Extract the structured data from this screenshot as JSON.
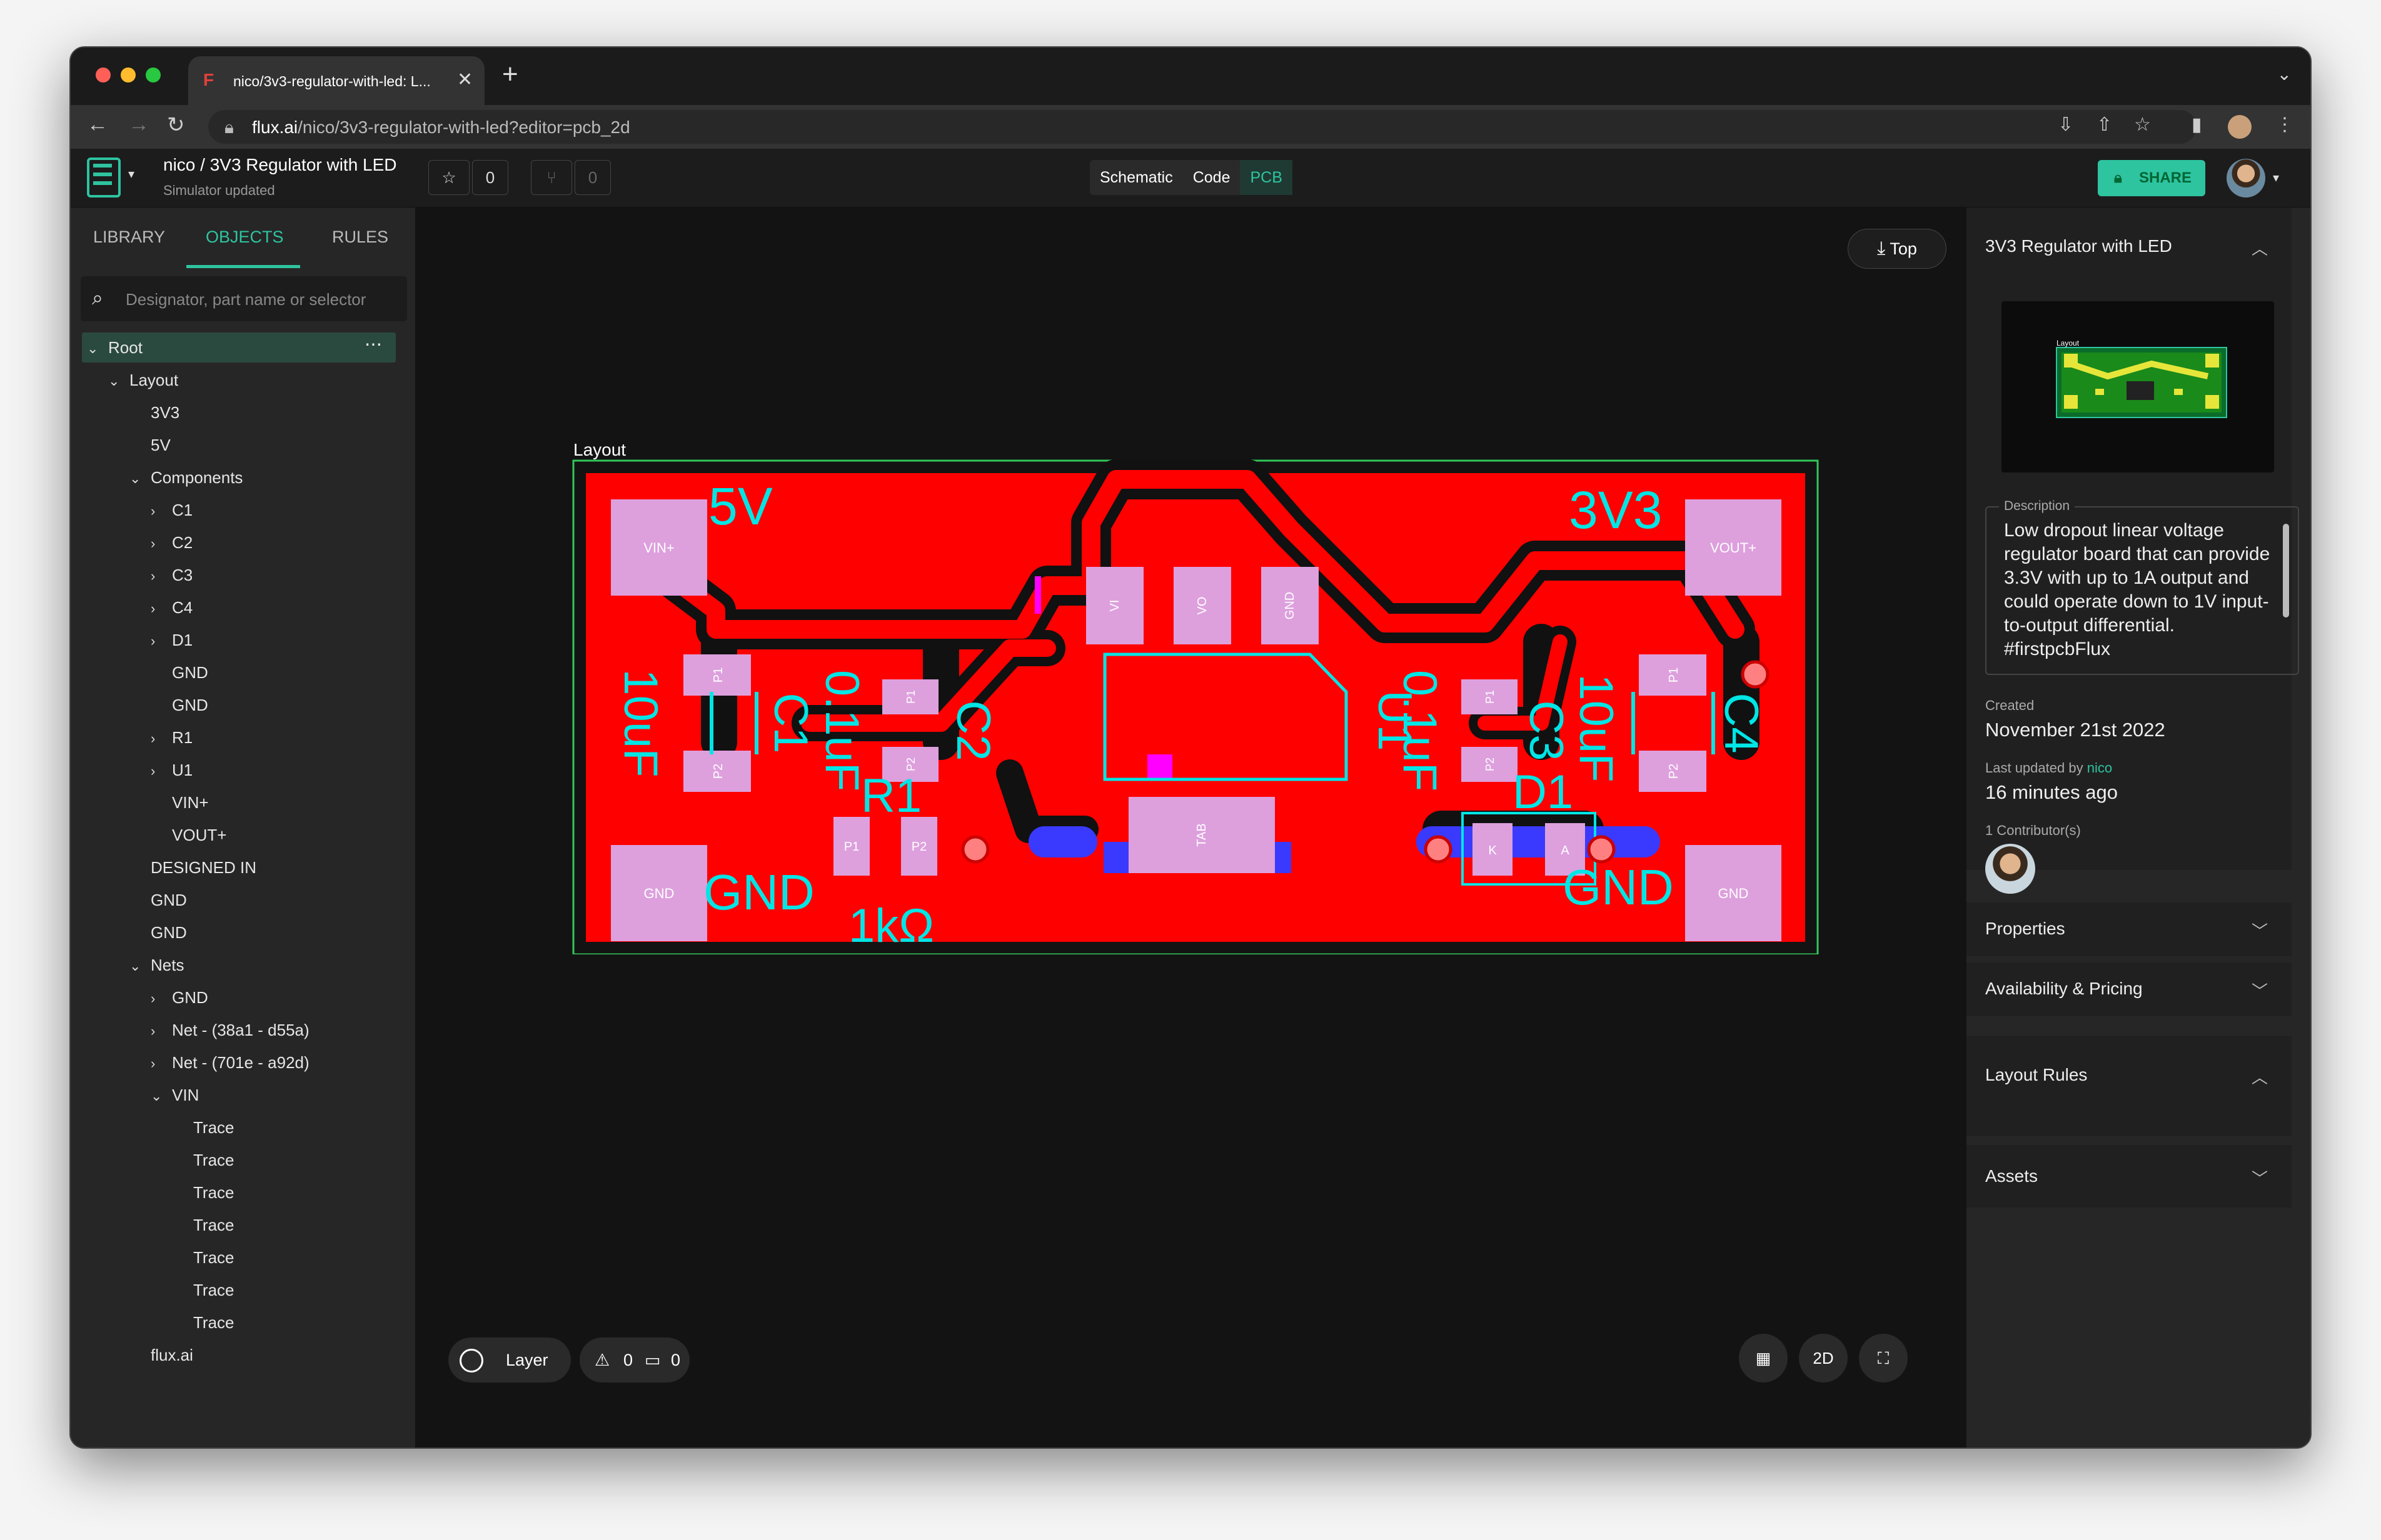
{
  "browser": {
    "tab_title": "nico/3v3-regulator-with-led: L...",
    "url_host": "flux.ai",
    "url_path": "/nico/3v3-regulator-with-led?editor=pcb_2d"
  },
  "header": {
    "project_title": "nico / 3V3 Regulator with LED",
    "status": "Simulator updated",
    "star_count": "0",
    "fork_count": "0",
    "views": [
      "Schematic",
      "Code",
      "PCB"
    ],
    "share_label": "SHARE"
  },
  "left_panel": {
    "tabs": [
      "LIBRARY",
      "OBJECTS",
      "RULES"
    ],
    "search_placeholder": "Designator, part name or selector",
    "tree": [
      {
        "label": "Root",
        "level": 0,
        "caret": "down"
      },
      {
        "label": "Layout",
        "level": 1,
        "caret": "down"
      },
      {
        "label": "3V3",
        "level": 2,
        "caret": ""
      },
      {
        "label": "5V",
        "level": 2,
        "caret": ""
      },
      {
        "label": "Components",
        "level": 2,
        "caret": "down"
      },
      {
        "label": "C1",
        "level": 3,
        "caret": "right"
      },
      {
        "label": "C2",
        "level": 3,
        "caret": "right"
      },
      {
        "label": "C3",
        "level": 3,
        "caret": "right"
      },
      {
        "label": "C4",
        "level": 3,
        "caret": "right"
      },
      {
        "label": "D1",
        "level": 3,
        "caret": "right"
      },
      {
        "label": "GND",
        "level": 3,
        "caret": ""
      },
      {
        "label": "GND",
        "level": 3,
        "caret": ""
      },
      {
        "label": "R1",
        "level": 3,
        "caret": "right"
      },
      {
        "label": "U1",
        "level": 3,
        "caret": "right"
      },
      {
        "label": "VIN+",
        "level": 3,
        "caret": ""
      },
      {
        "label": "VOUT+",
        "level": 3,
        "caret": ""
      },
      {
        "label": "DESIGNED IN",
        "level": 2,
        "caret": ""
      },
      {
        "label": "GND",
        "level": 2,
        "caret": ""
      },
      {
        "label": "GND",
        "level": 2,
        "caret": ""
      },
      {
        "label": "Nets",
        "level": 2,
        "caret": "down"
      },
      {
        "label": "GND",
        "level": 3,
        "caret": "right"
      },
      {
        "label": "Net - (38a1 - d55a)",
        "level": 3,
        "caret": "right"
      },
      {
        "label": "Net - (701e - a92d)",
        "level": 3,
        "caret": "right"
      },
      {
        "label": "VIN",
        "level": 3,
        "caret": "down"
      },
      {
        "label": "Trace",
        "level": 4,
        "caret": ""
      },
      {
        "label": "Trace",
        "level": 4,
        "caret": ""
      },
      {
        "label": "Trace",
        "level": 4,
        "caret": ""
      },
      {
        "label": "Trace",
        "level": 4,
        "caret": ""
      },
      {
        "label": "Trace",
        "level": 4,
        "caret": ""
      },
      {
        "label": "Trace",
        "level": 4,
        "caret": ""
      },
      {
        "label": "Trace",
        "level": 4,
        "caret": ""
      },
      {
        "label": "flux.ai",
        "level": 2,
        "caret": ""
      }
    ]
  },
  "canvas": {
    "layer_side": "Top",
    "frame_label": "Layout",
    "layer_button": "Layer",
    "warnings": "0",
    "comments": "0",
    "view_mode": "2D",
    "pcb": {
      "net_labels": {
        "vin": "5V",
        "vout": "3V3",
        "gnd_left": "GND",
        "gnd_right": "GND"
      },
      "pads": {
        "vin": "VIN+",
        "vout": "VOUT+",
        "gnd": "GND",
        "vi": "VI",
        "vo": "VO",
        "u_gnd": "GND",
        "tab": "TAB",
        "p1": "P1",
        "p2": "P2",
        "k": "K",
        "a": "A"
      },
      "designators": {
        "c1": "C1",
        "c2": "C2",
        "c3": "C3",
        "c4": "C4",
        "r1": "R1",
        "u1": "U1",
        "d1": "D1"
      },
      "values": {
        "c1": "10uF",
        "c2": "0.1uF",
        "c3": "0.1uF",
        "c4": "10uF",
        "r1": "1kΩ"
      }
    }
  },
  "right_panel": {
    "project_name": "3V3 Regulator with LED",
    "thumb_label": "Layout",
    "description_label": "Description",
    "description": "Low dropout linear voltage regulator board that can provide 3.3V with up to 1A output and could operate down to 1V input-to-output differential. #firstpcbFlux",
    "created_label": "Created",
    "created": "November 21st 2022",
    "updated_by_label": "Last updated by",
    "updated_by": "nico",
    "updated": "16 minutes ago",
    "contributors": "1 Contributor(s)",
    "sections": [
      "Properties",
      "Availability & Pricing",
      "Layout Rules",
      "Assets"
    ]
  },
  "colors": {
    "accent": "#2ec4a0",
    "copper": "#ff0000",
    "pad": "#dda0dd",
    "silkscreen": "#00e5e5"
  }
}
